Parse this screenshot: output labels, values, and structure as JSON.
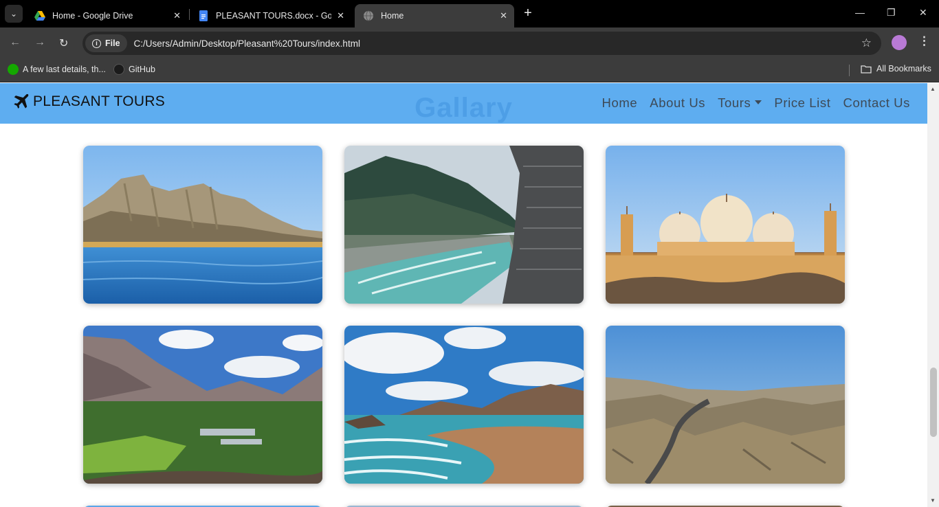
{
  "browser": {
    "tabs": [
      {
        "title": "Home - Google Drive",
        "icon": "google-drive-icon"
      },
      {
        "title": "PLEASANT TOURS.docx - Goog",
        "icon": "google-docs-icon"
      },
      {
        "title": "Home",
        "icon": "globe-icon",
        "active": true
      }
    ],
    "address": {
      "scheme_label": "File",
      "url": "C:/Users/Admin/Desktop/Pleasant%20Tours/index.html"
    },
    "bookmarks": [
      {
        "label": "A few last details, th...",
        "icon": "upwork-icon"
      },
      {
        "label": "GitHub",
        "icon": "github-icon"
      }
    ],
    "all_bookmarks_label": "All Bookmarks"
  },
  "site": {
    "brand": "PLEASANT TOURS",
    "section_heading": "Gallary",
    "nav": {
      "home": "Home",
      "about": "About Us",
      "tours": "Tours",
      "price": "Price List",
      "contact": "Contact Us"
    },
    "gallery": [
      {
        "subject": "rocky-cliffs-over-lake-image"
      },
      {
        "subject": "river-valley-image"
      },
      {
        "subject": "mosque-domes-image"
      },
      {
        "subject": "mountain-valley-village-image"
      },
      {
        "subject": "beach-coast-image"
      },
      {
        "subject": "desert-canyon-road-image"
      }
    ]
  },
  "colors": {
    "navbar": "#5eadf0",
    "nav_text": "#3d4a57",
    "chrome_dark": "#3c3c3c"
  }
}
